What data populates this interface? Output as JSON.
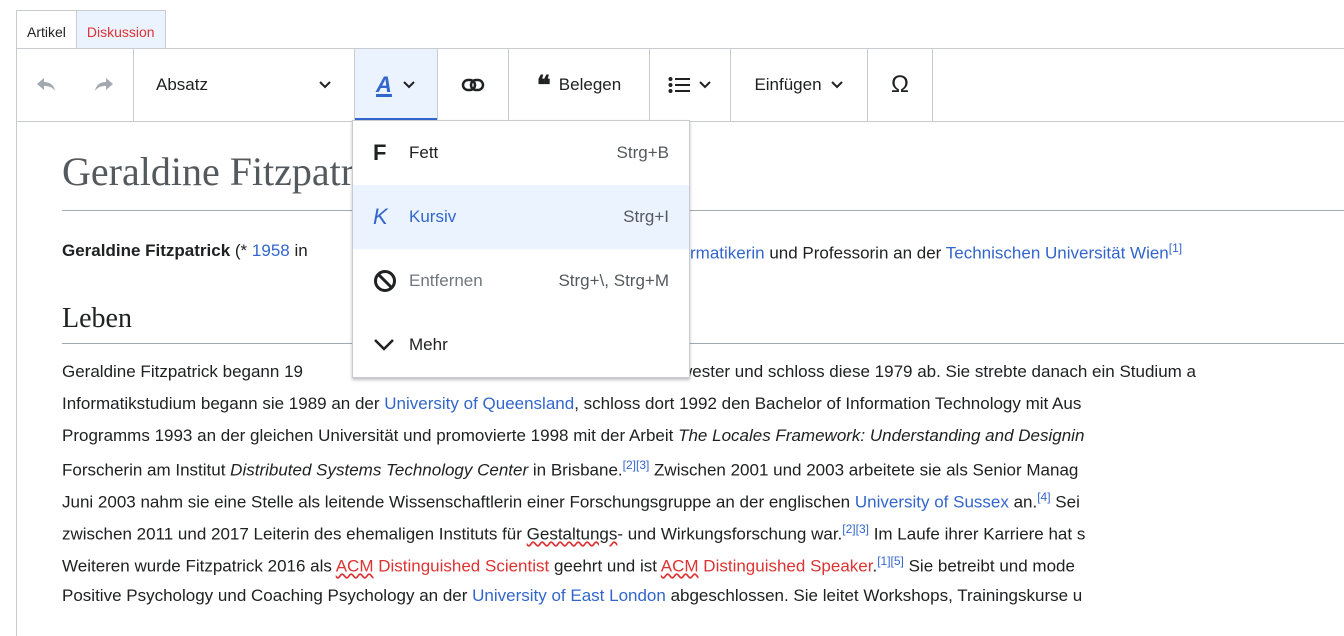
{
  "tabs": [
    "Artikel",
    "Diskussion"
  ],
  "toolbar": {
    "paragraph_label": "Absatz",
    "style_letter": "A",
    "cite_label": "Belegen",
    "insert_label": "Einfügen",
    "special_char": "Ω"
  },
  "article": {
    "title": "Geraldine Fitzpatrick",
    "intro_left": {
      "bold": "Geraldine Fitzpatrick",
      "t1": " (* ",
      "year": "1958",
      "t2": " in"
    },
    "intro_right": {
      "link1": "rmatikerin",
      "t1": " und Professorin an der ",
      "link2": "Technischen Universität Wien",
      "ref": "[1]"
    },
    "section_heading": "Leben",
    "para_left": [
      "Geraldine Fitzpatrick begann 19"
    ],
    "para_right": [
      "wester und schloss diese 1979 ab. Sie strebte danach ein Studium a"
    ],
    "lines": [
      {
        "t1": "Informatikstudium begann sie 1989 an der ",
        "l1": "University of Queensland",
        "t2": ", schloss dort 1992 den Bachelor of Information Technology mit Aus"
      },
      {
        "t1": "Programms 1993 an der gleichen Universität und promovierte 1998 mit der Arbeit ",
        "i1": "The Locales Framework: Understanding and Designin"
      },
      {
        "t1": "Forscherin am Institut ",
        "i1": "Distributed Systems Technology Center",
        "t2": " in Brisbane.",
        "r1": "[2][3]",
        "t3": " Zwischen 2001 und 2003 arbeitete sie als Senior Manag"
      },
      {
        "t1": "Juni 2003 nahm sie eine Stelle als leitende Wissenschaftlerin einer Forschungsgruppe an der englischen ",
        "l1": "University of Sussex",
        "t2": " an.",
        "r1": "[4]",
        "t3": " Sei"
      },
      {
        "t1": "zwischen 2011 und 2017 Leiterin des ehemaligen Instituts für ",
        "u1": "Gestaltungs",
        "t2": "- und Wirkungsforschung war.",
        "r1": "[2][3]",
        "t3": " Im Laufe ihrer Karriere hat s"
      },
      {
        "t1": "Weiteren wurde Fitzpatrick 2016 als ",
        "red1": "ACM",
        "red2": " Distinguished Scientist",
        "t2": " geehrt und ist ",
        "red3": "ACM",
        "red4": " Distinguished Speaker",
        "t3": ".",
        "r1": "[1][5]",
        "t4": " Sie betreibt und mode"
      },
      {
        "t1": "Positive Psychology und Coaching Psychology an der ",
        "l1": "University of East London",
        "t2": " abgeschlossen. Sie leitet Workshops, Trainingskurse u"
      }
    ]
  },
  "style_menu": {
    "items": [
      {
        "icon": "F",
        "label": "Fett",
        "shortcut": "Strg+B"
      },
      {
        "icon": "K",
        "label": "Kursiv",
        "shortcut": "Strg+I"
      },
      {
        "icon": "cancel-icon",
        "label": "Entfernen",
        "shortcut": "Strg+\\, Strg+M"
      },
      {
        "icon": "chevron-down-icon",
        "label": "Mehr",
        "shortcut": ""
      }
    ]
  },
  "colors": {
    "link": "#3366cc",
    "redlink": "#dd3333",
    "active_bg": "#eaf3ff",
    "border": "#c8ccd1"
  }
}
